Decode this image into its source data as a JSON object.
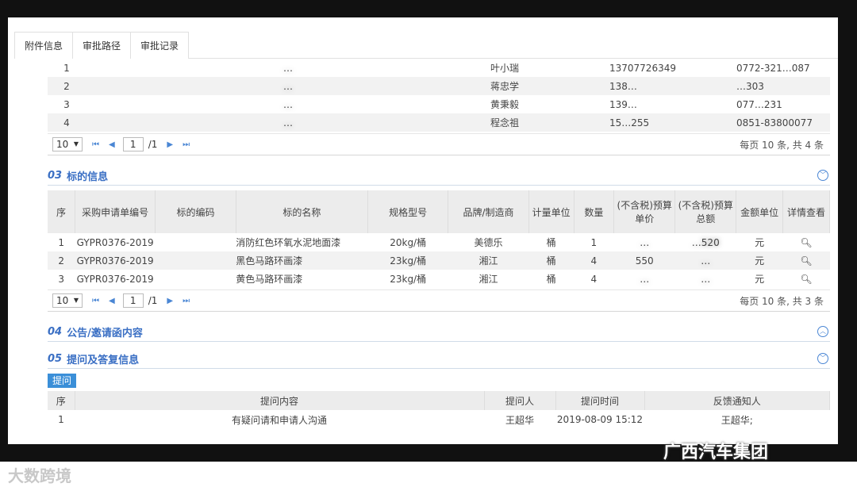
{
  "tabs": [
    "附件信息",
    "审批路径",
    "审批记录"
  ],
  "suppliers": {
    "rows": [
      {
        "idx": "1",
        "name": "…",
        "contact": "叶小瑞",
        "phone": "13707726349",
        "tel": "0772-321…087"
      },
      {
        "idx": "2",
        "name": "…",
        "contact": "蒋忠学",
        "phone": "138…",
        "tel": "…303"
      },
      {
        "idx": "3",
        "name": "…",
        "contact": "黄秉毅",
        "phone": "139…",
        "tel": "077…231"
      },
      {
        "idx": "4",
        "name": "…",
        "contact": "程念祖",
        "phone": "15…255",
        "tel": "0851-83800077"
      }
    ],
    "pager": {
      "size": "10",
      "page": "1",
      "total": "/1",
      "info": "每页 10 条, 共 4 条"
    }
  },
  "section3": {
    "num": "03",
    "title": "标的信息",
    "headers": [
      "序",
      "采购申请单编号",
      "标的编码",
      "标的名称",
      "规格型号",
      "品牌/制造商",
      "计量单位",
      "数量",
      "(不含税)预算单价",
      "(不含税)预算总额",
      "金额单位",
      "详情查看"
    ],
    "rows": [
      {
        "idx": "1",
        "code": "GYPR0376-2019",
        "item_code": "",
        "name": "消防红色环氧水泥地面漆",
        "spec": "20kg/桶",
        "brand": "美德乐",
        "unit": "桶",
        "qty": "1",
        "price": "…",
        "total": "…520",
        "currency": "元"
      },
      {
        "idx": "2",
        "code": "GYPR0376-2019",
        "item_code": "",
        "name": "黑色马路环画漆",
        "spec": "23kg/桶",
        "brand": "湘江",
        "unit": "桶",
        "qty": "4",
        "price": "550",
        "total": "…",
        "currency": "元"
      },
      {
        "idx": "3",
        "code": "GYPR0376-2019",
        "item_code": "",
        "name": "黄色马路环画漆",
        "spec": "23kg/桶",
        "brand": "湘江",
        "unit": "桶",
        "qty": "4",
        "price": "…",
        "total": "…",
        "currency": "元"
      }
    ],
    "pager": {
      "size": "10",
      "page": "1",
      "total": "/1",
      "info": "每页 10 条, 共 3 条"
    }
  },
  "section4": {
    "num": "04",
    "title": "公告/邀请函内容"
  },
  "section5": {
    "num": "05",
    "title": "提问及答复信息",
    "ask_button": "提问",
    "headers": [
      "序",
      "提问内容",
      "提问人",
      "提问时间",
      "反馈通知人"
    ],
    "rows": [
      {
        "idx": "1",
        "content": "有疑问请和申请人沟通",
        "asker": "王超华",
        "time": "2019-08-09 15:12",
        "notify": "王超华;"
      }
    ]
  },
  "watermarks": {
    "left": "大数跨境",
    "right": "广西汽车集团"
  }
}
